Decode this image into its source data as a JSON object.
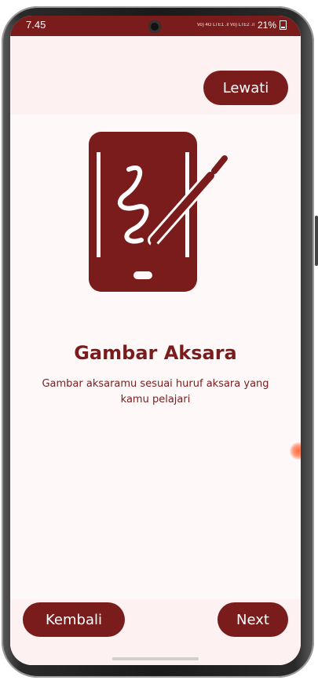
{
  "status_bar": {
    "time": "7.45",
    "network": "Vo) 4G LTE1 .ıl Vo) LTE2 .ıl",
    "battery": "21%"
  },
  "onboarding": {
    "skip_label": "Lewati",
    "title": "Gambar Aksara",
    "description": "Gambar aksaramu sesuai huruf aksara yang kamu pelajari",
    "illustration_icon": "tablet-drawing-icon",
    "back_label": "Kembali",
    "next_label": "Next"
  },
  "colors": {
    "primary": "#7b1c1c",
    "background": "#fff8f8"
  }
}
